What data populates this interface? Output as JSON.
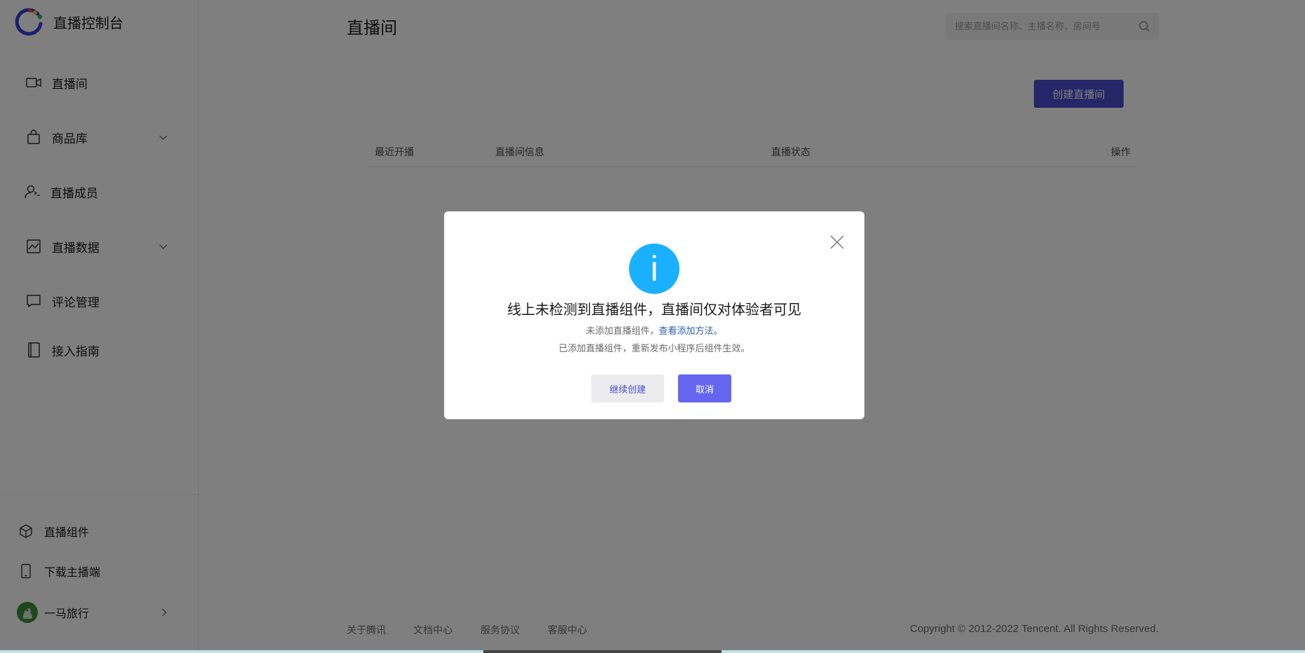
{
  "brand": {
    "title": "直播控制台"
  },
  "sidebar": {
    "items": [
      {
        "label": "直播间",
        "icon": "video-camera-icon"
      },
      {
        "label": "商品库",
        "icon": "shopping-bag-icon",
        "expandable": true
      },
      {
        "label": "直播成员",
        "icon": "users-icon"
      },
      {
        "label": "直播数据",
        "icon": "chart-icon",
        "expandable": true
      },
      {
        "label": "评论管理",
        "icon": "comment-icon"
      },
      {
        "label": "接入指南",
        "icon": "book-icon"
      }
    ],
    "bottom": [
      {
        "label": "直播组件",
        "icon": "cube-icon"
      },
      {
        "label": "下载主播端",
        "icon": "phone-icon"
      }
    ],
    "user": {
      "name": "一马旅行"
    }
  },
  "header": {
    "title": "直播间",
    "search_placeholder": "搜索直播间名称、主播名称、房间号"
  },
  "main": {
    "create_button": "创建直播间",
    "table_headers": [
      "最近开播",
      "直播间信息",
      "直播状态",
      "操作"
    ]
  },
  "footer": {
    "links": [
      "关于腾讯",
      "文档中心",
      "服务协议",
      "客服中心"
    ],
    "copyright": "Copyright © 2012-2022 Tencent. All Rights Reserved."
  },
  "modal": {
    "icon": "info-icon",
    "icon_glyph": "i",
    "title": "线上未检测到直播组件，直播间仅对体验者可见",
    "line1_text": "未添加直播组件，",
    "line1_link": "查看添加方法。",
    "line2": "已添加直播组件，重新发布小程序后组件生效。",
    "continue_button": "继续创建",
    "cancel_button": "取消"
  },
  "colors": {
    "accent": "#4a4dcf",
    "modal_primary": "#6466f0",
    "info": "#1ab0ff",
    "link": "#2a5db0"
  }
}
